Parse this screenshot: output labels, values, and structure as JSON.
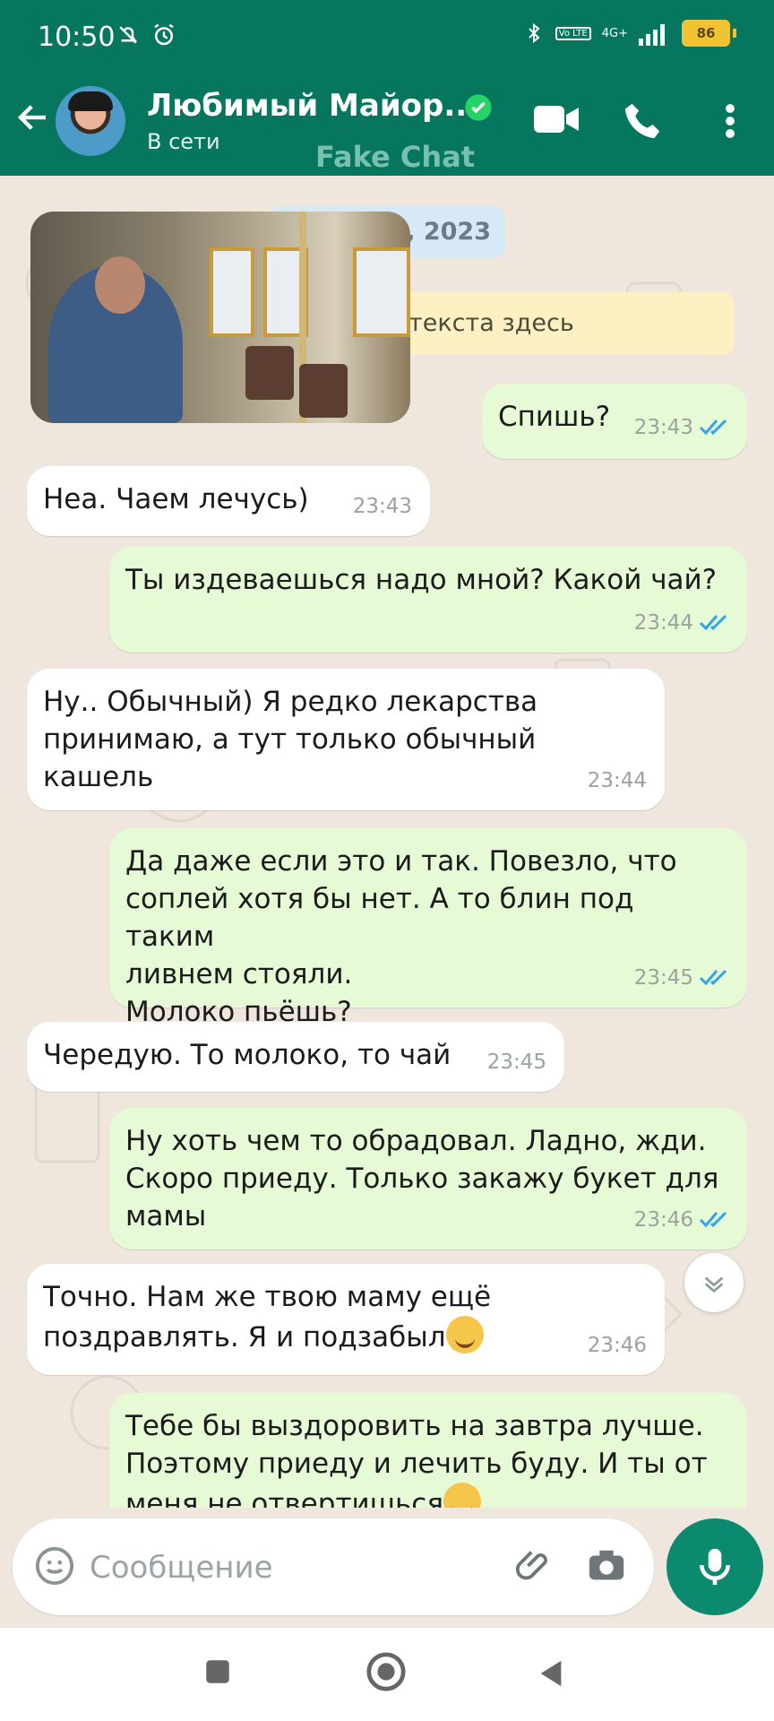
{
  "status_bar": {
    "time": "10:50",
    "network": "4G+",
    "volte": "Vo LTE",
    "battery": "86"
  },
  "header": {
    "contact_name": "Любимый Майор...",
    "contact_status": "В сети",
    "watermark": "Fake Chat"
  },
  "chat": {
    "date_chip": "7, 2023",
    "encryption_notice": "текста здесь",
    "messages": [
      {
        "dir": "out",
        "text": "Спишь?",
        "time": "23:43",
        "read": true
      },
      {
        "dir": "in",
        "text": "Неа. Чаем лечусь)",
        "time": "23:43"
      },
      {
        "dir": "out",
        "text": "Ты издеваешься надо мной? Какой чай?",
        "time": "23:44",
        "read": true
      },
      {
        "dir": "in",
        "text": "Ну.. Обычный) Я редко лекарства\nпринимаю, а тут только обычный\nкашель",
        "time": "23:44"
      },
      {
        "dir": "out",
        "text": "Да даже если это и так. Повезло, что\nсоплей хотя бы нет. А то блин под таким\nливнем стояли.\nМолоко пьёшь?",
        "time": "23:45",
        "read": true
      },
      {
        "dir": "in",
        "text": "Чередую. То молоко, то чай",
        "time": "23:45"
      },
      {
        "dir": "out",
        "text": "Ну хоть чем то обрадовал. Ладно, жди.\nСкоро приеду. Только закажу букет для\nмамы",
        "time": "23:46",
        "read": true
      },
      {
        "dir": "in",
        "text": "Точно. Нам же твою маму ещё\nпоздравлять. Я и подзабыл",
        "time": "23:46"
      },
      {
        "dir": "out",
        "text": "Тебе бы выздоровить на завтра лучше.\nПоэтому приеду и лечить буду. И ты от\nменя не отвертишься",
        "time": "",
        "read": false
      }
    ]
  },
  "composer": {
    "placeholder": "Сообщение"
  },
  "colors": {
    "header": "#06765f",
    "out_bubble": "#e6fad5",
    "in_bubble": "#ffffff",
    "accent": "#0b8a70",
    "read_tick": "#34a4ea"
  },
  "icons": [
    "back-arrow-icon",
    "verified-icon",
    "video-call-icon",
    "phone-icon",
    "more-icon",
    "emoji-icon",
    "attach-icon",
    "camera-icon",
    "mic-icon",
    "scroll-down-icon",
    "nav-square-icon",
    "nav-home-icon",
    "nav-back-icon"
  ]
}
